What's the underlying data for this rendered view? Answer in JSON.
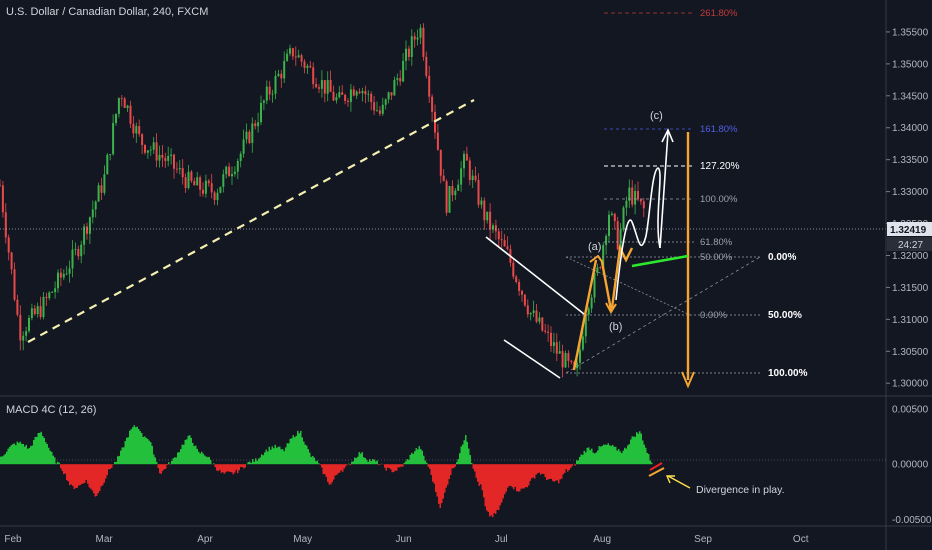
{
  "header": {
    "title": "U.S. Dollar / Canadian Dollar, 240, FXCM"
  },
  "macd": {
    "title": "MACD 4C (12, 26)"
  },
  "chart_data": [
    {
      "type": "candlestick",
      "series": [
        {
          "name": "USDCAD close",
          "x": [
            "2017-01-28",
            "2017-02-03",
            "2017-02-10",
            "2017-02-20",
            "2017-03-01",
            "2017-03-06",
            "2017-03-12",
            "2017-03-20",
            "2017-03-28",
            "2017-04-04",
            "2017-04-12",
            "2017-04-20",
            "2017-04-28",
            "2017-05-05",
            "2017-05-12",
            "2017-05-18",
            "2017-05-25",
            "2017-06-01",
            "2017-06-06",
            "2017-06-09",
            "2017-06-14",
            "2017-06-20",
            "2017-06-26",
            "2017-07-03",
            "2017-07-10",
            "2017-07-18",
            "2017-07-24",
            "2017-07-27",
            "2017-07-31",
            "2017-08-03",
            "2017-08-06",
            "2017-08-09",
            "2017-08-14"
          ],
          "values": [
            1.331,
            1.308,
            1.312,
            1.32,
            1.332,
            1.346,
            1.338,
            1.335,
            1.331,
            1.33,
            1.336,
            1.345,
            1.352,
            1.348,
            1.344,
            1.347,
            1.342,
            1.35,
            1.356,
            1.346,
            1.328,
            1.335,
            1.326,
            1.32,
            1.311,
            1.305,
            1.301,
            1.312,
            1.318,
            1.327,
            1.322,
            1.33,
            1.327
          ]
        }
      ],
      "price_scale": {
        "labels": [
          "1.35500",
          "1.35000",
          "1.34500",
          "1.34000",
          "1.33500",
          "1.33000",
          "1.32500",
          "1.32000",
          "1.31500",
          "1.31000",
          "1.30500",
          "1.30000"
        ],
        "range": [
          1.298,
          1.36
        ]
      },
      "current_price": "1.32419",
      "countdown": "24:27",
      "time_axis": [
        "Feb",
        "Mar",
        "Apr",
        "May",
        "Jun",
        "Jul",
        "Aug",
        "Sep",
        "Oct"
      ],
      "fibonacci_extension": [
        "261.80%",
        "161.80%",
        "127.20%",
        "100.00%",
        "61.80%",
        "50.00%",
        "0.00%"
      ],
      "fibonacci_retracement": [
        "0.00%",
        "50.00%",
        "100.00%"
      ],
      "wave_labels": [
        "(a)",
        "(b)",
        "(c)"
      ]
    },
    {
      "type": "histogram",
      "series": [
        {
          "name": "MACD 4C (12, 26)"
        }
      ],
      "scale_labels": [
        "0.00500",
        "0.00000",
        "-0.00500"
      ],
      "range": [
        -0.0056,
        0.006
      ],
      "annotation": "Divergence in play."
    }
  ]
}
